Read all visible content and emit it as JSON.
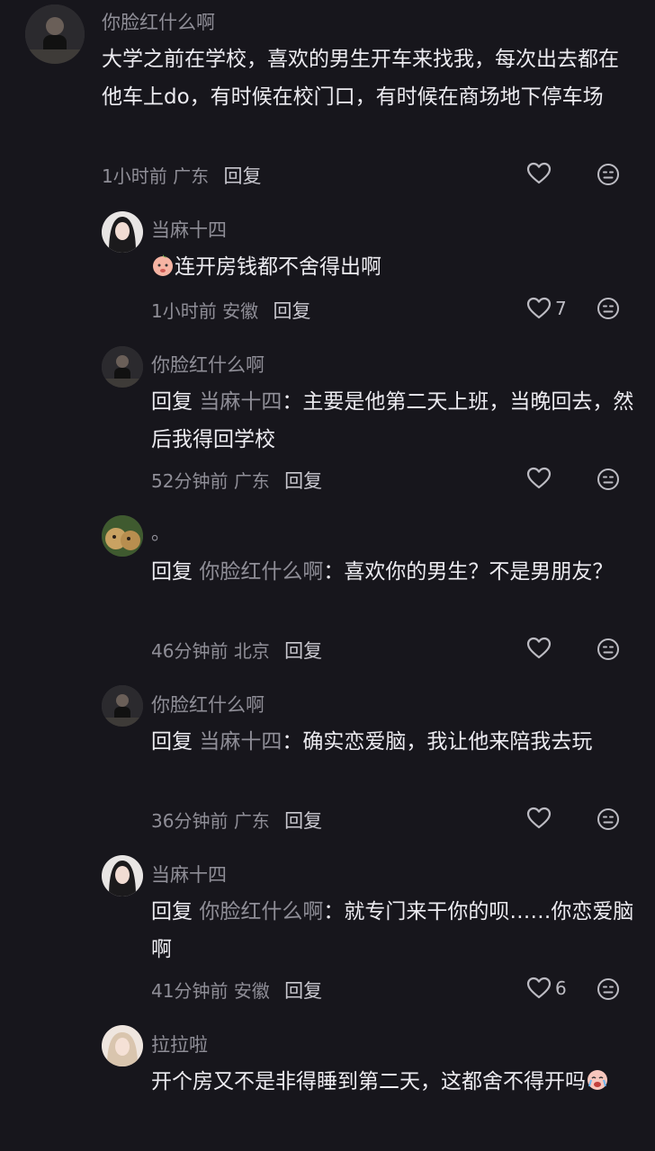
{
  "comments": [
    {
      "name": "你脸红什么啊",
      "text": "大学之前在学校，喜欢的男生开车来找我，每次出去都在他车上do，有时候在校门口，有时候在商场地下停车场",
      "time": "1小时前",
      "region": "广东",
      "reply_label": "回复",
      "likes": ""
    },
    {
      "name": "当麻十四",
      "text": "连开房钱都不舍得出啊",
      "time": "1小时前",
      "region": "安徽",
      "reply_label": "回复",
      "likes": "7"
    },
    {
      "name": "你脸红什么啊",
      "reply_prefix": "回复",
      "reply_target": "当麻十四",
      "text": "：主要是他第二天上班，当晚回去，然后我得回学校",
      "time": "52分钟前",
      "region": "广东",
      "reply_label": "回复",
      "likes": ""
    },
    {
      "name": "。",
      "reply_prefix": "回复",
      "reply_target": "你脸红什么啊",
      "text": "：喜欢你的男生？不是男朋友？",
      "time": "46分钟前",
      "region": "北京",
      "reply_label": "回复",
      "likes": ""
    },
    {
      "name": "你脸红什么啊",
      "reply_prefix": "回复",
      "reply_target": "当麻十四",
      "text": "：确实恋爱脑，我让他来陪我去玩",
      "time": "36分钟前",
      "region": "广东",
      "reply_label": "回复",
      "likes": ""
    },
    {
      "name": "当麻十四",
      "reply_prefix": "回复",
      "reply_target": "你脸红什么啊",
      "text": "：就专门来干你的呗……你恋爱脑啊",
      "time": "41分钟前",
      "region": "安徽",
      "reply_label": "回复",
      "likes": "6"
    },
    {
      "name": "拉拉啦",
      "text": "开个房又不是非得睡到第二天，这都舍不得开吗"
    }
  ],
  "icons": {
    "like": "heart-outline-icon",
    "dislike": "meh-face-icon"
  },
  "colors": {
    "background": "#17161c",
    "text": "#ecebf0",
    "muted": "#8f8e97"
  }
}
